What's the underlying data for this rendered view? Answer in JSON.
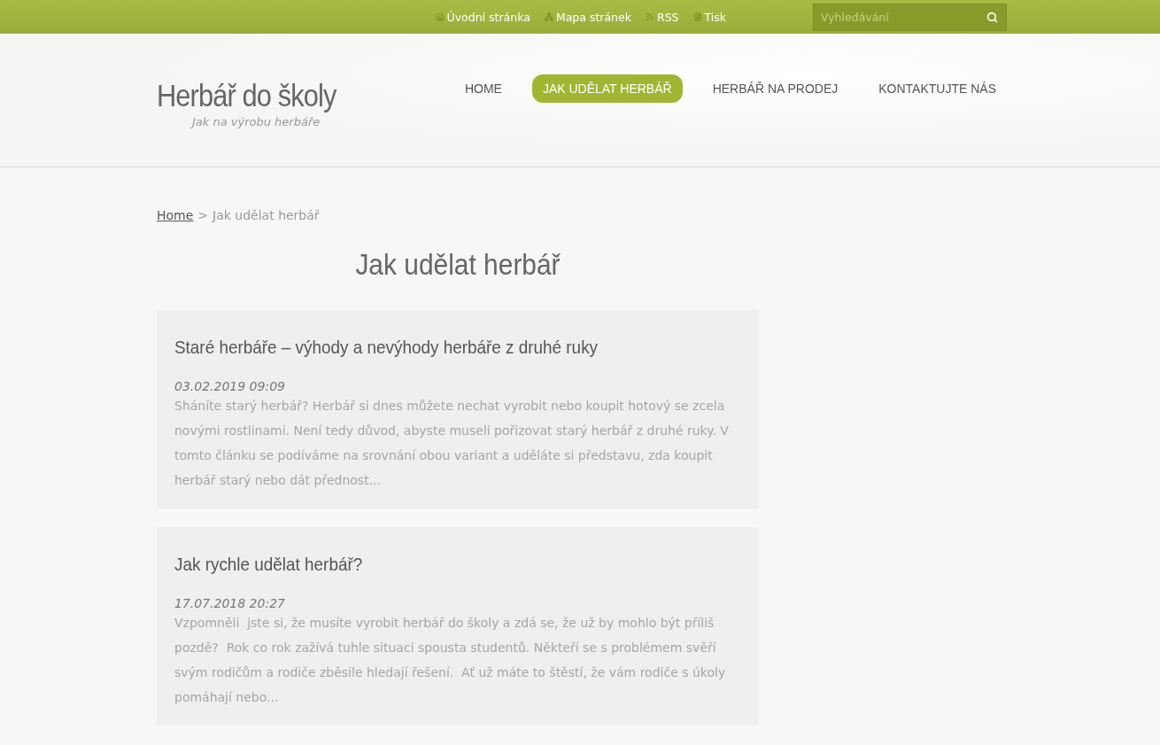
{
  "top_links": [
    {
      "label": "Úvodní stránka"
    },
    {
      "label": "Mapa stránek"
    },
    {
      "label": "RSS"
    },
    {
      "label": "Tisk"
    }
  ],
  "search": {
    "placeholder": "Vyhledávání"
  },
  "site": {
    "title": "Herbář do školy",
    "tagline": "Jak na výrobu herbáře"
  },
  "nav": [
    {
      "label": "HOME",
      "selected": false
    },
    {
      "label": "JAK UDĚLAT HERBÁŘ",
      "selected": true
    },
    {
      "label": "HERBÁŘ NA PRODEJ",
      "selected": false
    },
    {
      "label": "KONTAKTUJTE NÁS",
      "selected": false
    }
  ],
  "breadcrumb": {
    "link": "Home",
    "separator": ">",
    "current": "Jak udělat herbář"
  },
  "page_title": "Jak udělat herbář",
  "articles": [
    {
      "title": "Staré herbáře – výhody a nevýhody herbáře z druhé ruky",
      "date": "03.02.2019 09:09",
      "excerpt": "Sháníte starý herbář? Herbář si dnes můžete nechat vyrobit nebo koupit hotový se zcela novými rostlinami. Není tedy důvod, abyste museli pořizovat starý herbář z druhé ruky. V tomto článku se podíváme na srovnání obou variant a uděláte si představu, zda koupit herbář starý nebo dát přednost..."
    },
    {
      "title": "Jak rychle udělat herbář?",
      "date": "17.07.2018 20:27",
      "excerpt": "Vzpomněli  jste si, že musíte vyrobit herbář do školy a zdá se, že už by mohlo být příliš pozdě?  Rok co rok zažívá tuhle situaci spousta studentů. Někteří se s problémem svěří svým rodičům a rodiče zběsile hledají řešení.  Ať už máte to štěstí, že vám rodiče s úkoly pomáhají nebo..."
    }
  ]
}
